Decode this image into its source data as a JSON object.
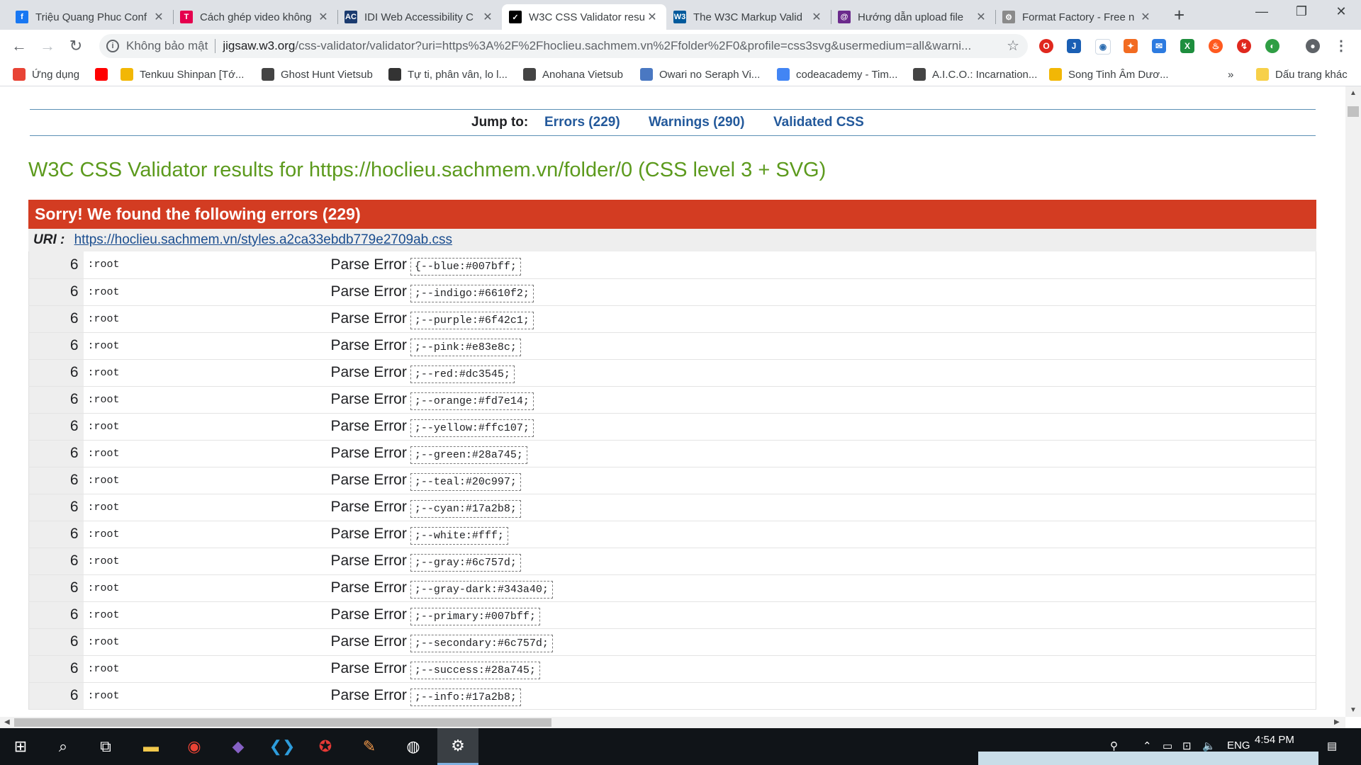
{
  "browser": {
    "tabs": [
      {
        "title": "Triệu Quang Phuc Conf",
        "icon": "facebook-icon",
        "color": "#1877f2",
        "glyph": "f"
      },
      {
        "title": "Cách ghép video không",
        "icon": "t-logo-icon",
        "color": "#e5004e",
        "glyph": "T"
      },
      {
        "title": "IDI Web Accessibility C",
        "icon": "ac-logo-icon",
        "color": "#1b3b6f",
        "glyph": "AC"
      },
      {
        "title": "W3C CSS Validator resu",
        "icon": "w3c-validator-icon",
        "color": "#000000",
        "glyph": "✓"
      },
      {
        "title": "The W3C Markup Valid",
        "icon": "w3c-icon",
        "color": "#005a9c",
        "glyph": "W3"
      },
      {
        "title": "Hướng dẫn upload file",
        "icon": "q-logo-icon",
        "color": "#6b2a8c",
        "glyph": "@"
      },
      {
        "title": "Format Factory - Free n",
        "icon": "format-factory-icon",
        "color": "#8a8a8a",
        "glyph": "⚙"
      }
    ],
    "active_tab": 3,
    "address": {
      "security_label": "Không bảo mật",
      "url_host": "jigsaw.w3.org",
      "url_rest": "/css-validator/validator?uri=https%3A%2F%2Fhoclieu.sachmem.vn%2Ffolder%2F0&profile=css3svg&usermedium=all&warni..."
    },
    "bookmarks": [
      {
        "label": "Ứng dụng",
        "icon": "apps-grid-icon",
        "color": "#e84335"
      },
      {
        "label": "",
        "icon": "youtube-icon",
        "color": "#ff0000"
      },
      {
        "label": "Tenkuu Shinpan [Tớ...",
        "icon": "n-logo-icon",
        "color": "#f2b705"
      },
      {
        "label": "Ghost Hunt Vietsub",
        "icon": "figure-icon",
        "color": "#444444"
      },
      {
        "label": "Tự ti, phân vân, lo l...",
        "icon": "globe-icon",
        "color": "#333333"
      },
      {
        "label": "Anohana Vietsub",
        "icon": "figure-icon",
        "color": "#444444"
      },
      {
        "label": "Owari no Seraph Vi...",
        "icon": "grid-doc-icon",
        "color": "#4a78c2"
      },
      {
        "label": "codeacademy - Tim...",
        "icon": "google-icon",
        "color": "#4285f4"
      },
      {
        "label": "A.I.C.O.: Incarnation...",
        "icon": "figure-icon",
        "color": "#444444"
      },
      {
        "label": "Song Tinh Âm Dươ...",
        "icon": "n-logo-icon",
        "color": "#f2b705"
      }
    ],
    "bookmarks_overflow": "»",
    "other_bookmarks": "Dấu trang khác"
  },
  "page": {
    "jump_label": "Jump to:",
    "jump_links": [
      "Errors (229)",
      "Warnings (290)",
      "Validated CSS"
    ],
    "title": "W3C CSS Validator results for https://hoclieu.sachmem.vn/folder/0 (CSS level 3 + SVG)",
    "error_banner": "Sorry! We found the following errors (229)",
    "uri_label": "URI :",
    "uri_link": "https://hoclieu.sachmem.vn/styles.a2ca33ebdb779e2709ab.css",
    "errors": [
      {
        "line": "6",
        "context": ":root",
        "type": "Parse Error",
        "code": "{--blue:#007bff;"
      },
      {
        "line": "6",
        "context": ":root",
        "type": "Parse Error",
        "code": ";--indigo:#6610f2;"
      },
      {
        "line": "6",
        "context": ":root",
        "type": "Parse Error",
        "code": ";--purple:#6f42c1;"
      },
      {
        "line": "6",
        "context": ":root",
        "type": "Parse Error",
        "code": ";--pink:#e83e8c;"
      },
      {
        "line": "6",
        "context": ":root",
        "type": "Parse Error",
        "code": ";--red:#dc3545;"
      },
      {
        "line": "6",
        "context": ":root",
        "type": "Parse Error",
        "code": ";--orange:#fd7e14;"
      },
      {
        "line": "6",
        "context": ":root",
        "type": "Parse Error",
        "code": ";--yellow:#ffc107;"
      },
      {
        "line": "6",
        "context": ":root",
        "type": "Parse Error",
        "code": ";--green:#28a745;"
      },
      {
        "line": "6",
        "context": ":root",
        "type": "Parse Error",
        "code": ";--teal:#20c997;"
      },
      {
        "line": "6",
        "context": ":root",
        "type": "Parse Error",
        "code": ";--cyan:#17a2b8;"
      },
      {
        "line": "6",
        "context": ":root",
        "type": "Parse Error",
        "code": ";--white:#fff;"
      },
      {
        "line": "6",
        "context": ":root",
        "type": "Parse Error",
        "code": ";--gray:#6c757d;"
      },
      {
        "line": "6",
        "context": ":root",
        "type": "Parse Error",
        "code": ";--gray-dark:#343a40;"
      },
      {
        "line": "6",
        "context": ":root",
        "type": "Parse Error",
        "code": ";--primary:#007bff;"
      },
      {
        "line": "6",
        "context": ":root",
        "type": "Parse Error",
        "code": ";--secondary:#6c757d;"
      },
      {
        "line": "6",
        "context": ":root",
        "type": "Parse Error",
        "code": ";--success:#28a745;"
      },
      {
        "line": "6",
        "context": ":root",
        "type": "Parse Error",
        "code": ";--info:#17a2b8;"
      }
    ]
  },
  "taskbar": {
    "apps": [
      "windows-start-icon",
      "search-icon",
      "task-view-icon",
      "file-explorer-icon",
      "chrome-icon",
      "visual-studio-icon",
      "vscode-icon",
      "garena-icon",
      "paint-icon",
      "obs-icon",
      "format-factory-icon"
    ],
    "language": "ENG",
    "time": "4:54 PM"
  },
  "colors": {
    "title_green": "#5c9a1d",
    "error_red": "#d33c22",
    "link_blue": "#23599b"
  }
}
